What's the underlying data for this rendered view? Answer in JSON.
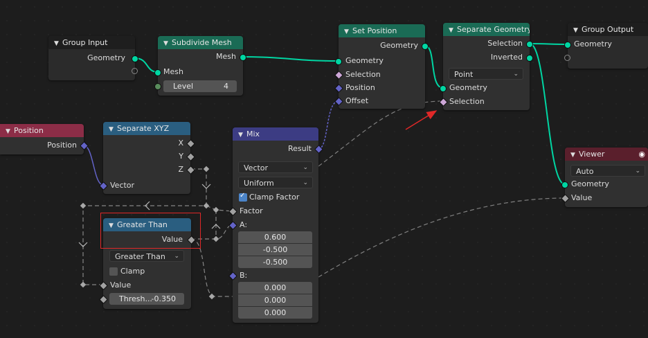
{
  "nodes": {
    "group_input": {
      "title": "Group Input",
      "geometry": "Geometry"
    },
    "subdivide_mesh": {
      "title": "Subdivide Mesh",
      "mesh_out": "Mesh",
      "mesh_in": "Mesh",
      "level_label": "Level",
      "level_value": "4"
    },
    "set_position": {
      "title": "Set Position",
      "geometry_out": "Geometry",
      "geometry_in": "Geometry",
      "selection": "Selection",
      "position": "Position",
      "offset": "Offset"
    },
    "separate_geometry": {
      "title": "Separate Geometry",
      "selection_out": "Selection",
      "inverted": "Inverted",
      "domain": "Point",
      "geometry_in": "Geometry",
      "selection_in": "Selection"
    },
    "group_output": {
      "title": "Group Output",
      "geometry": "Geometry"
    },
    "position": {
      "title": "Position",
      "position_out": "Position"
    },
    "separate_xyz": {
      "title": "Separate XYZ",
      "x": "X",
      "y": "Y",
      "z": "Z",
      "vector": "Vector"
    },
    "mix": {
      "title": "Mix",
      "result": "Result",
      "data_type": "Vector",
      "factor_mode": "Uniform",
      "clamp_factor": "Clamp Factor",
      "factor": "Factor",
      "a_label": "A:",
      "a_values": [
        "0.600",
        "-0.500",
        "-0.500"
      ],
      "b_label": "B:",
      "b_values": [
        "0.000",
        "0.000",
        "0.000"
      ]
    },
    "greater_than": {
      "title": "Greater Than",
      "value_out": "Value",
      "operation": "Greater Than",
      "clamp": "Clamp",
      "value_in": "Value",
      "threshold_label": "Thresh...",
      "threshold_value": "-0.350"
    },
    "viewer": {
      "title": "Viewer",
      "domain": "Auto",
      "geometry": "Geometry",
      "value": "Value"
    }
  },
  "colors": {
    "background": "#1d1d1d",
    "node_body": "#303030",
    "geometry_header": "#1a6b55",
    "converter_header": "#2a5e80",
    "input_header": "#8c2d47",
    "viewer_header": "#5a1f2c",
    "geometry_socket": "#00d6a3",
    "vector_socket": "#6363c7",
    "float_socket": "#a1a1a1",
    "bool_socket": "#cca6d6",
    "highlight": "#e02828"
  },
  "annotations": {
    "highlight_node": "greater_than",
    "arrow_target": "separate_geometry.selection_in"
  }
}
